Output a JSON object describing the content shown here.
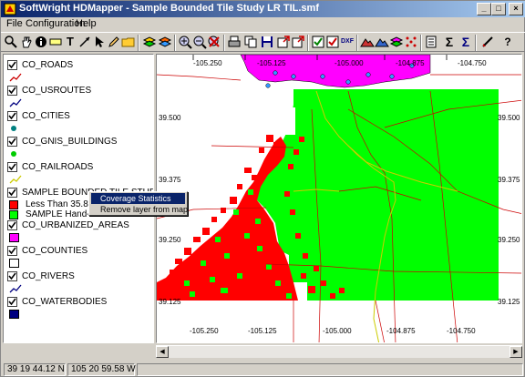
{
  "window": {
    "title": "SoftWright HDMapper - Sample Bounded Tile Study LR TIL.smf",
    "minimize_glyph": "_",
    "maximize_glyph": "□",
    "close_glyph": "×"
  },
  "menu": [
    "File",
    "Configuration",
    "Help"
  ],
  "toolbar": {
    "text_tool_glyph": "T",
    "dxf_label": "DXF",
    "sum_label": "Σ",
    "help_label": "?"
  },
  "layers": [
    {
      "name": "CO_ROADS",
      "checked": true,
      "symbol": "line",
      "color": "#cc0000"
    },
    {
      "name": "CO_USROUTES",
      "checked": true,
      "symbol": "line",
      "color": "#000080"
    },
    {
      "name": "CO_CITIES",
      "checked": true,
      "symbol": "dot",
      "color": "#008080"
    },
    {
      "name": "CO_GNIS_BUILDINGS",
      "checked": true,
      "symbol": "dot",
      "color": "#00cc00"
    },
    {
      "name": "CO_RAILROADS",
      "checked": true,
      "symbol": "line",
      "color": "#cccc00"
    },
    {
      "name": "SAMPLE BOUNDED TILE STUDY LR TIL",
      "checked": true,
      "symbol": "classes",
      "classes": [
        {
          "label": "Less Than 35.84",
          "color": "#ff0000"
        },
        {
          "label": "SAMPLE Hand-h",
          "color": "#00ff00"
        }
      ]
    },
    {
      "name": "CO_URBANIZED_AREAS",
      "checked": true,
      "symbol": "fill",
      "color": "#ff00ff"
    },
    {
      "name": "CO_COUNTIES",
      "checked": true,
      "symbol": "outline",
      "color": "#ffffff"
    },
    {
      "name": "CO_RIVERS",
      "checked": true,
      "symbol": "line",
      "color": "#000080"
    },
    {
      "name": "CO_WATERBODIES",
      "checked": true,
      "symbol": "fill",
      "color": "#000080"
    }
  ],
  "context_menu": [
    {
      "label": "Coverage Statistics",
      "selected": true
    },
    {
      "label": "Remove layer from map",
      "selected": false
    }
  ],
  "map": {
    "top_longitudes": [
      "-105.250",
      "-105.125",
      "-105.000",
      "-104.875",
      "-104.750"
    ],
    "bottom_longitudes": [
      "-105.250",
      "-105.125",
      "-105.000",
      "-104.875",
      "-104.750"
    ],
    "left_latitudes": [
      "39.500",
      "39.375",
      "39.250",
      "39.125"
    ],
    "right_latitudes": [
      "39.500",
      "39.375",
      "39.250",
      "39.125"
    ],
    "colors": {
      "coverage_low": "#ff0000",
      "coverage_high": "#00ff00",
      "urban": "#ff00ff",
      "roads": "#cc0000",
      "rivers": "#cccc00"
    }
  },
  "status": {
    "latitude": "39 19 44.12 N",
    "longitude": "105 20 59.58 W"
  }
}
